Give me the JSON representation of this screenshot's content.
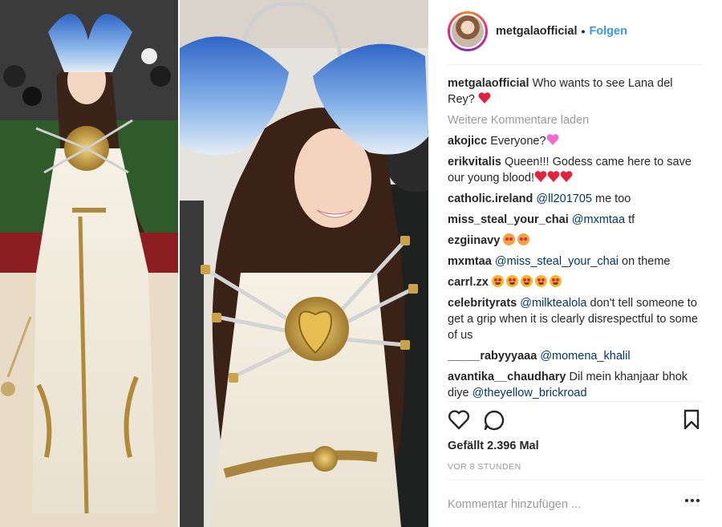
{
  "post": {
    "username": "metgalaofficial",
    "separator": "•",
    "follow_label": "Folgen",
    "caption": {
      "user": "metgalaofficial",
      "text": "Who wants to see Lana del Rey?",
      "emoji": "red-heart"
    },
    "load_more_label": "Weitere Kommentare laden",
    "comments": [
      {
        "user": "akojicc",
        "text": "Everyone?",
        "emoji": "pink-heart"
      },
      {
        "user": "erikvitalis",
        "text": "Queen!!! Godess came here to save our young blood!",
        "emoji": "red-heart x3"
      },
      {
        "user": "catholic.ireland",
        "mention": "@ll201705",
        "text": " me too"
      },
      {
        "user": "miss_steal_your_chai",
        "mention": "@mxmtaa",
        "text": " tf"
      },
      {
        "user": "ezgiinavy",
        "text": "",
        "emoji": "heart-eyes-cat x2"
      },
      {
        "user": "mxmtaa",
        "mention": "@miss_steal_your_chai",
        "text": " on theme"
      },
      {
        "user": "carrl.zx",
        "text": "",
        "emoji": "heart-eyes x5"
      },
      {
        "user": "celebrityrats",
        "mention": "@milktealola",
        "text": " don't tell someone to get a grip when it is clearly disrespectful to some of us"
      },
      {
        "user": "_____rabyyyaaa",
        "mention": "@momena_khalil",
        "text": ""
      },
      {
        "user": "avantika__chaudhary",
        "text": "Dil mein khanjaar bhok diye ",
        "mention2": "@theyellow_brickroad"
      }
    ],
    "likes_label": "Gefällt 2.396 Mal",
    "time_label": "VOR 8 STUNDEN",
    "comment_placeholder": "Kommentar hinzufügen ...",
    "icons": [
      "heart-icon",
      "comment-icon",
      "bookmark-icon",
      "more-options-icon"
    ],
    "colors": {
      "link": "#3897f0",
      "mention": "#003569",
      "muted": "#999999"
    }
  }
}
